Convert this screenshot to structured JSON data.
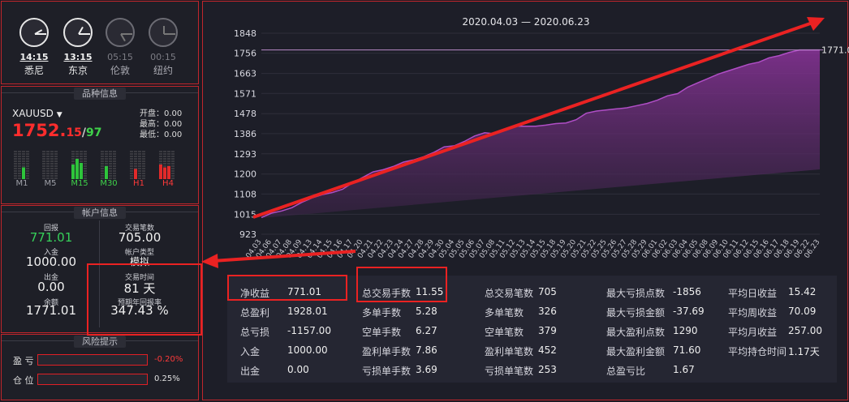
{
  "clocks": [
    {
      "time": "14:15",
      "city": "悉尼"
    },
    {
      "time": "13:15",
      "city": "东京"
    },
    {
      "time": "05:15",
      "city": "伦敦"
    },
    {
      "time": "00:15",
      "city": "纽约"
    }
  ],
  "instrument": {
    "title": "品种信息",
    "symbol": "XAUUSD",
    "price_main": "1752.",
    "price_sub": "15",
    "price_sep": "/",
    "price_alt": "97",
    "open": "开盘：0.00",
    "high": "最高：0.00",
    "low": "最低：0.00",
    "timeframes": [
      "M1",
      "M5",
      "M15",
      "M30",
      "H1",
      "H4"
    ]
  },
  "account": {
    "title": "帐户信息",
    "return_label": "回报",
    "return_value": "771.01",
    "trades_label": "交易笔数",
    "trades_value": "705.00",
    "deposit_label": "入金",
    "deposit_value": "1000.00",
    "account_type_label": "帐户类型",
    "account_type_value": "模拟",
    "withdraw_label": "出金",
    "withdraw_value": "0.00",
    "trade_time_label": "交易时间",
    "trade_time_value": "81 天",
    "balance_label": "余额",
    "balance_value": "1771.01",
    "annual_label": "预期年回报率",
    "annual_value": "347.43 %"
  },
  "risk": {
    "title": "风险提示",
    "pl_label": "盈 亏",
    "pl_value": "-0.20%",
    "pos_label": "仓 位",
    "pos_value": "0.25%"
  },
  "chart_data": {
    "type": "area",
    "title": "2020.04.03 — 2020.06.23",
    "ylim": [
      923,
      1848
    ],
    "yticks": [
      1848,
      1756,
      1663,
      1571,
      1478,
      1386,
      1293,
      1200,
      1108,
      1015,
      923
    ],
    "last_value_label": "1771.0",
    "categories": [
      "04.03",
      "04.06",
      "04.07",
      "04.08",
      "04.09",
      "04.13",
      "04.14",
      "04.15",
      "04.16",
      "04.17",
      "04.20",
      "04.21",
      "04.22",
      "04.23",
      "04.24",
      "04.27",
      "04.28",
      "04.29",
      "04.30",
      "05.04",
      "05.05",
      "05.06",
      "05.07",
      "05.08",
      "05.11",
      "05.12",
      "05.13",
      "05.14",
      "05.15",
      "05.18",
      "05.19",
      "05.20",
      "05.21",
      "05.22",
      "05.25",
      "05.26",
      "05.27",
      "05.28",
      "05.29",
      "06.01",
      "06.02",
      "06.03",
      "06.04",
      "06.05",
      "06.08",
      "06.09",
      "06.10",
      "06.11",
      "06.12",
      "06.15",
      "06.16",
      "06.17",
      "06.18",
      "06.19",
      "06.22",
      "06.23"
    ],
    "values": [
      1000,
      1020,
      1030,
      1045,
      1070,
      1090,
      1105,
      1115,
      1130,
      1160,
      1185,
      1210,
      1220,
      1235,
      1255,
      1265,
      1280,
      1300,
      1325,
      1330,
      1350,
      1375,
      1390,
      1385,
      1405,
      1420,
      1420,
      1420,
      1425,
      1432,
      1435,
      1450,
      1480,
      1490,
      1495,
      1500,
      1505,
      1515,
      1525,
      1540,
      1560,
      1570,
      1600,
      1620,
      1640,
      1660,
      1675,
      1690,
      1705,
      1715,
      1735,
      1745,
      1760,
      1771,
      1771,
      1771
    ]
  },
  "stats": {
    "col1": [
      {
        "label": "净收益",
        "value": "771.01"
      },
      {
        "label": "总盈利",
        "value": "1928.01"
      },
      {
        "label": "总亏损",
        "value": "-1157.00"
      },
      {
        "label": "入金",
        "value": "1000.00"
      },
      {
        "label": "出金",
        "value": "0.00"
      }
    ],
    "col2": [
      {
        "label": "总交易手数",
        "value": "11.55"
      },
      {
        "label": "多单手数",
        "value": "5.28"
      },
      {
        "label": "空单手数",
        "value": "6.27"
      },
      {
        "label": "盈利单手数",
        "value": "7.86"
      },
      {
        "label": "亏损单手数",
        "value": "3.69"
      }
    ],
    "col3": [
      {
        "label": "总交易笔数",
        "value": "705"
      },
      {
        "label": "多单笔数",
        "value": "326"
      },
      {
        "label": "空单笔数",
        "value": "379"
      },
      {
        "label": "盈利单笔数",
        "value": "452"
      },
      {
        "label": "亏损单笔数",
        "value": "253"
      }
    ],
    "col4": [
      {
        "label": "最大亏损点数",
        "value": "-1856"
      },
      {
        "label": "最大亏损金额",
        "value": "-37.69"
      },
      {
        "label": "最大盈利点数",
        "value": "1290"
      },
      {
        "label": "最大盈利金额",
        "value": "71.60"
      },
      {
        "label": "总盈亏比",
        "value": "1.67"
      }
    ],
    "col5": [
      {
        "label": "平均日收益",
        "value": "15.42"
      },
      {
        "label": "平均周收益",
        "value": "70.09"
      },
      {
        "label": "平均月收益",
        "value": "257.00"
      },
      {
        "label": "平均持仓时间",
        "value": "1.17天"
      }
    ]
  },
  "colors": {
    "accent": "#ea2222",
    "area": "#7a2f8a",
    "positive": "#36d05a",
    "negative": "#ff2d2d"
  }
}
